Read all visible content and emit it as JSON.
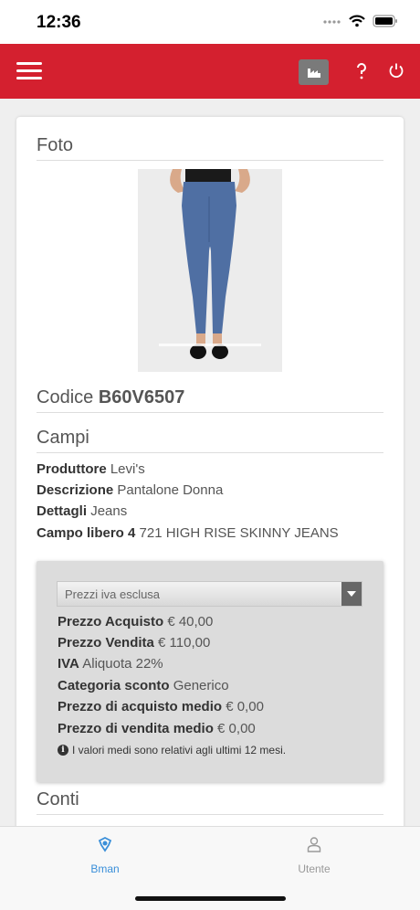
{
  "status": {
    "time": "12:36"
  },
  "colors": {
    "brand": "#d4202f",
    "accent": "#3a8fd9"
  },
  "toolbar": {
    "icons": [
      "menu-icon",
      "factory-icon",
      "help-icon",
      "power-icon"
    ]
  },
  "sections": {
    "foto": "Foto",
    "codice_label": "Codice",
    "codice_value": "B60V6507",
    "campi": "Campi",
    "conti": "Conti"
  },
  "fields": [
    {
      "label": "Produttore",
      "value": "Levi's"
    },
    {
      "label": "Descrizione",
      "value": "Pantalone Donna"
    },
    {
      "label": "Dettagli",
      "value": "Jeans"
    },
    {
      "label": "Campo libero 4",
      "value": "721 HIGH RISE SKINNY JEANS"
    }
  ],
  "prices": {
    "select_value": "Prezzi iva esclusa",
    "rows": [
      {
        "label": "Prezzo Acquisto",
        "value": "€ 40,00"
      },
      {
        "label": "Prezzo Vendita",
        "value": "€ 110,00"
      },
      {
        "label": "IVA",
        "value": "Aliquota 22%"
      },
      {
        "label": "Categoria sconto",
        "value": "Generico"
      },
      {
        "label": "Prezzo di acquisto medio",
        "value": "€ 0,00"
      },
      {
        "label": "Prezzo di vendita medio",
        "value": "€ 0,00"
      }
    ],
    "note": "I valori medi sono relativi agli ultimi 12 mesi."
  },
  "tabs": [
    {
      "label": "Bman",
      "icon": "bman-icon",
      "active": true
    },
    {
      "label": "Utente",
      "icon": "user-icon",
      "active": false
    }
  ]
}
